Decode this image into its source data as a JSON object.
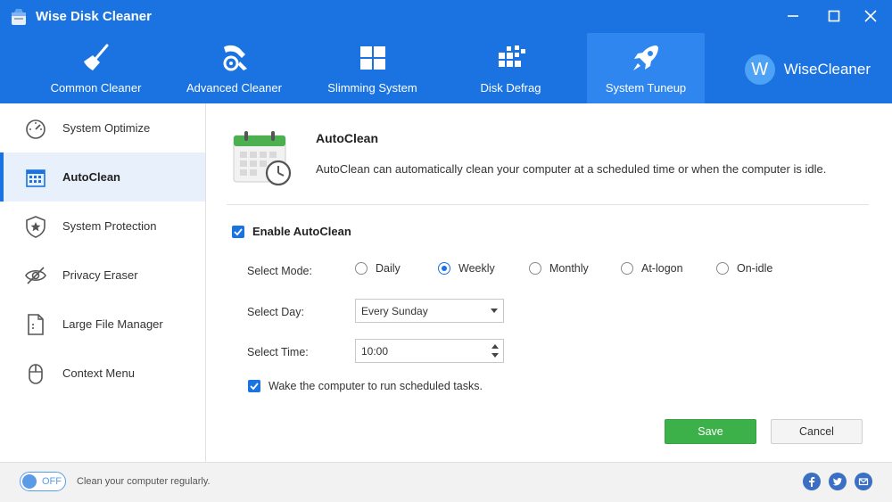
{
  "window": {
    "title": "Wise Disk Cleaner"
  },
  "main_tabs": [
    {
      "label": "Common Cleaner",
      "icon": "broom-icon"
    },
    {
      "label": "Advanced Cleaner",
      "icon": "tools-icon"
    },
    {
      "label": "Slimming System",
      "icon": "windows-icon"
    },
    {
      "label": "Disk Defrag",
      "icon": "defrag-icon"
    },
    {
      "label": "System Tuneup",
      "icon": "rocket-icon",
      "active": true
    }
  ],
  "brand": {
    "logo_letter": "W",
    "name": "WiseCleaner"
  },
  "sidebar": {
    "items": [
      {
        "label": "System Optimize",
        "icon": "gauge-icon"
      },
      {
        "label": "AutoClean",
        "icon": "calendar-icon",
        "active": true
      },
      {
        "label": "System Protection",
        "icon": "shield-icon"
      },
      {
        "label": "Privacy Eraser",
        "icon": "eye-off-icon"
      },
      {
        "label": "Large File Manager",
        "icon": "file-icon"
      },
      {
        "label": "Context Menu",
        "icon": "mouse-icon"
      }
    ]
  },
  "autoclean": {
    "title": "AutoClean",
    "description": "AutoClean can automatically clean your computer at a scheduled time or when the computer is idle.",
    "enable_label": "Enable AutoClean",
    "enable_checked": true,
    "mode_label": "Select Mode:",
    "modes": [
      "Daily",
      "Weekly",
      "Monthly",
      "At-logon",
      "On-idle"
    ],
    "selected_mode": "Weekly",
    "day_label": "Select Day:",
    "day_value": "Every Sunday",
    "time_label": "Select Time:",
    "time_value": "10:00",
    "wake_label": "Wake the computer to run scheduled tasks.",
    "wake_checked": true,
    "save_label": "Save",
    "cancel_label": "Cancel"
  },
  "footer": {
    "toggle_label": "OFF",
    "text": "Clean your computer regularly.",
    "social": [
      "facebook-icon",
      "twitter-icon",
      "email-icon"
    ]
  },
  "colors": {
    "header_bg": "#1a73e0",
    "active_tab_bg": "#2f86ee",
    "save_green": "#3cb14a"
  }
}
